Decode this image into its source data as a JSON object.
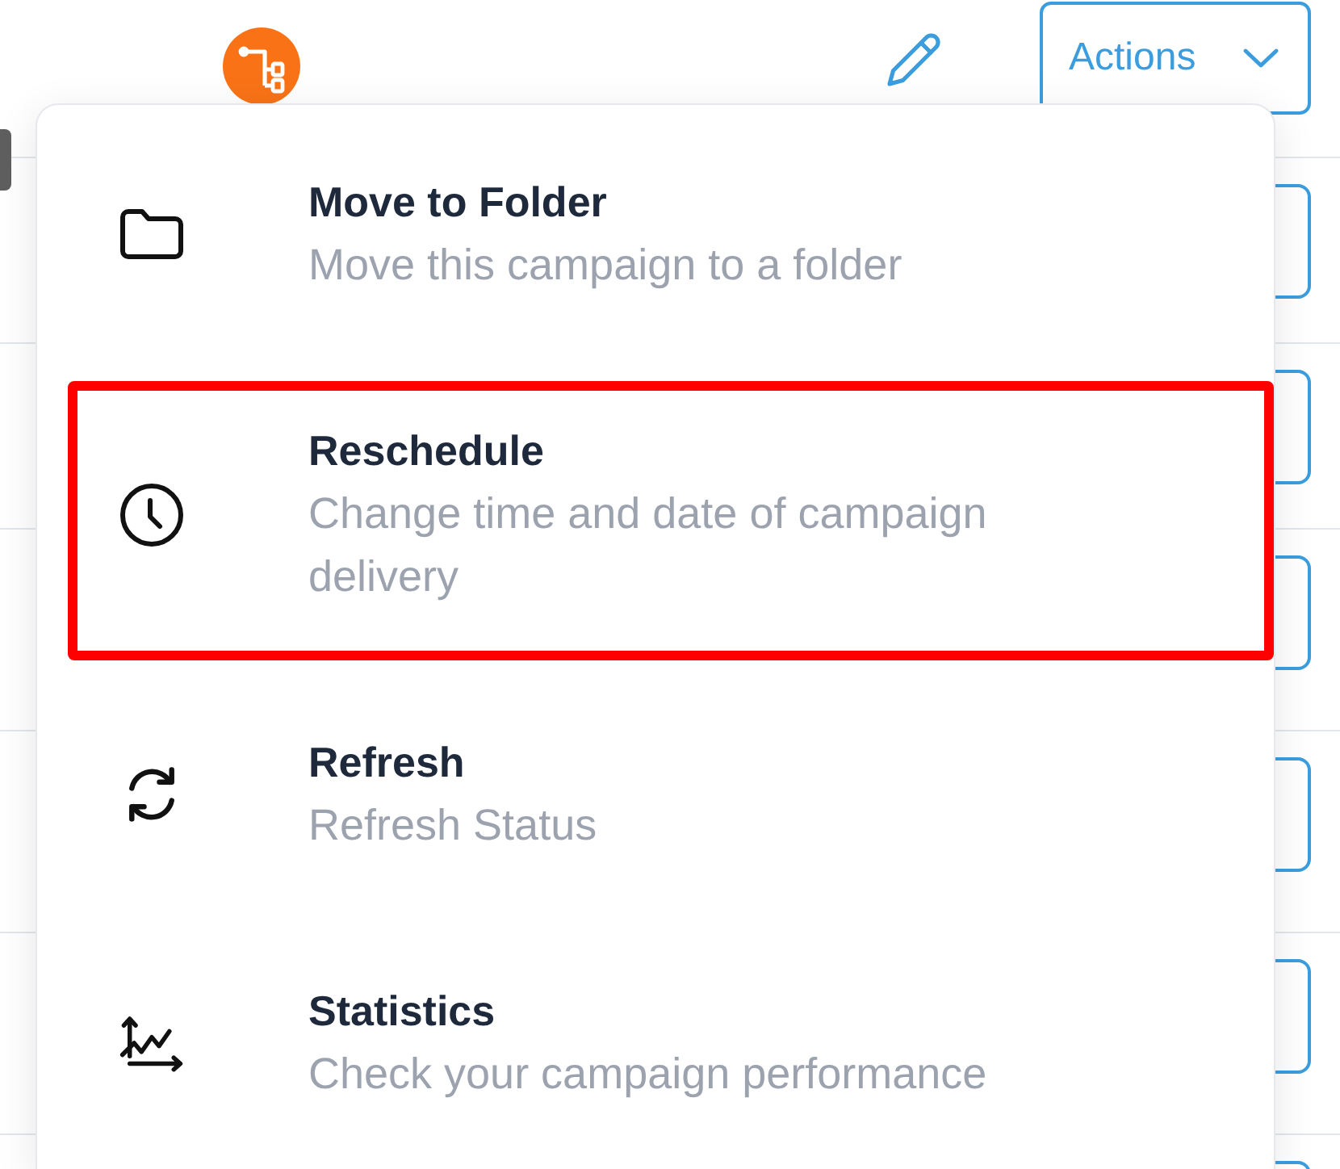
{
  "header": {
    "actions_button": {
      "label": "Actions"
    }
  },
  "rows": [
    {
      "has_button": true
    },
    {
      "has_button": true
    },
    {
      "has_button": true
    },
    {
      "has_button": true
    },
    {
      "has_button": true
    },
    {
      "has_button": true
    }
  ],
  "menu": {
    "items": [
      {
        "title": "Move to Folder",
        "description": "Move this campaign to a folder",
        "highlighted": false
      },
      {
        "title": "Reschedule",
        "description": "Change time and date of campaign delivery",
        "highlighted": true
      },
      {
        "title": "Refresh",
        "description": "Refresh Status",
        "highlighted": false
      },
      {
        "title": "Statistics",
        "description": "Check your campaign performance",
        "highlighted": false
      }
    ]
  }
}
